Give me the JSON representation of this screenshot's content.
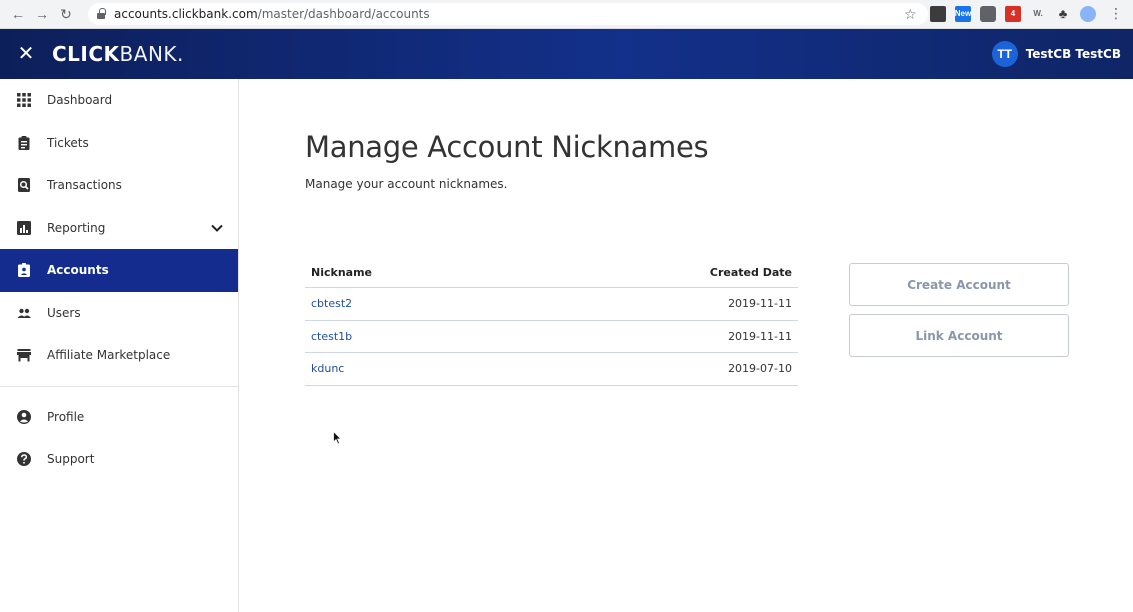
{
  "browser": {
    "url_host": "accounts.clickbank.com",
    "url_path": "/master/dashboard/accounts",
    "extensions": [
      {
        "name": "ext-1",
        "color": "#3c3c3c",
        "label": ""
      },
      {
        "name": "ext-new",
        "color": "#1a73e8",
        "label": "New"
      },
      {
        "name": "ext-camera",
        "color": "#5f6368",
        "label": ""
      },
      {
        "name": "ext-red",
        "color": "#d93025",
        "label": "4"
      },
      {
        "name": "ext-w",
        "color": "#9aa0a6",
        "label": "W."
      },
      {
        "name": "ext-puzzle",
        "color": "#5f6368",
        "label": ""
      },
      {
        "name": "ext-profile",
        "color": "#8ab4f8",
        "label": ""
      }
    ]
  },
  "header": {
    "logo_bold": "CLICK",
    "logo_light": "BANK.",
    "user_initials": "TT",
    "user_name": "TestCB TestCB"
  },
  "sidebar": {
    "items": [
      {
        "label": "Dashboard",
        "icon": "grid-icon"
      },
      {
        "label": "Tickets",
        "icon": "clipboard-icon"
      },
      {
        "label": "Transactions",
        "icon": "receipt-search-icon"
      },
      {
        "label": "Reporting",
        "icon": "bar-chart-icon"
      },
      {
        "label": "Accounts",
        "icon": "id-badge-icon",
        "active": true
      },
      {
        "label": "Users",
        "icon": "users-icon"
      },
      {
        "label": "Affiliate Marketplace",
        "icon": "store-icon"
      }
    ],
    "secondary": [
      {
        "label": "Profile",
        "icon": "user-circle-icon"
      },
      {
        "label": "Support",
        "icon": "help-circle-icon"
      }
    ]
  },
  "main": {
    "title": "Manage Account Nicknames",
    "subtitle": "Manage your account nicknames.",
    "table": {
      "headers": {
        "nickname": "Nickname",
        "created": "Created Date"
      },
      "rows": [
        {
          "nickname": "cbtest2",
          "created": "2019-11-11"
        },
        {
          "nickname": "ctest1b",
          "created": "2019-11-11"
        },
        {
          "nickname": "kdunc",
          "created": "2019-07-10"
        }
      ]
    },
    "buttons": {
      "create": "Create Account",
      "link": "Link Account"
    }
  },
  "colors": {
    "header_bg": "#13308a",
    "active_nav_bg": "#142c8e",
    "link": "#1f4fa8",
    "button_text": "#8a97ab"
  }
}
